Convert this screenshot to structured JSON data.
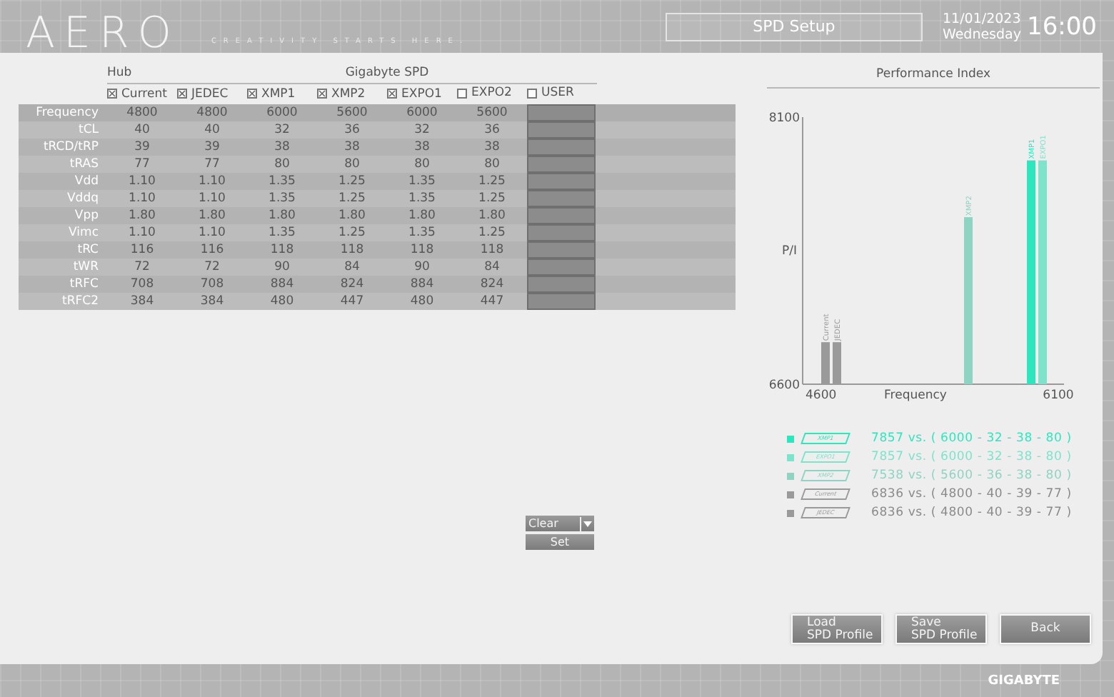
{
  "header": {
    "logo": "AERO",
    "tagline": "CREATIVITY STARTS HERE.",
    "title": "SPD Setup",
    "date": "11/01/2023",
    "day": "Wednesday",
    "time": "16:00"
  },
  "table": {
    "groups": [
      {
        "label": "Hub"
      },
      {
        "label": "Gigabyte SPD"
      }
    ],
    "columns": [
      {
        "label": "Current",
        "checked": true,
        "kind": "profile"
      },
      {
        "label": "JEDEC",
        "checked": true,
        "kind": "profile"
      },
      {
        "label": "XMP1",
        "checked": true,
        "kind": "profile"
      },
      {
        "label": "XMP2",
        "checked": true,
        "kind": "profile"
      },
      {
        "label": "EXPO1",
        "checked": true,
        "kind": "profile"
      },
      {
        "label": "EXPO2",
        "checked": false,
        "kind": "profile"
      },
      {
        "label": "USER",
        "checked": false,
        "kind": "user"
      }
    ],
    "rows": [
      {
        "label": "Frequency",
        "values": [
          "4800",
          "4800",
          "6000",
          "5600",
          "6000",
          "5600"
        ]
      },
      {
        "label": "tCL",
        "values": [
          "40",
          "40",
          "32",
          "36",
          "32",
          "36"
        ]
      },
      {
        "label": "tRCD/tRP",
        "values": [
          "39",
          "39",
          "38",
          "38",
          "38",
          "38"
        ]
      },
      {
        "label": "tRAS",
        "values": [
          "77",
          "77",
          "80",
          "80",
          "80",
          "80"
        ]
      },
      {
        "label": "Vdd",
        "values": [
          "1.10",
          "1.10",
          "1.35",
          "1.25",
          "1.35",
          "1.25"
        ]
      },
      {
        "label": "Vddq",
        "values": [
          "1.10",
          "1.10",
          "1.35",
          "1.25",
          "1.35",
          "1.25"
        ]
      },
      {
        "label": "Vpp",
        "values": [
          "1.80",
          "1.80",
          "1.80",
          "1.80",
          "1.80",
          "1.80"
        ]
      },
      {
        "label": "Vimc",
        "values": [
          "1.10",
          "1.10",
          "1.35",
          "1.25",
          "1.35",
          "1.25"
        ]
      },
      {
        "label": "tRC",
        "values": [
          "116",
          "116",
          "118",
          "118",
          "118",
          "118"
        ]
      },
      {
        "label": "tWR",
        "values": [
          "72",
          "72",
          "90",
          "84",
          "90",
          "84"
        ]
      },
      {
        "label": "tRFC",
        "values": [
          "708",
          "708",
          "884",
          "824",
          "884",
          "824"
        ]
      },
      {
        "label": "tRFC2",
        "values": [
          "384",
          "384",
          "480",
          "447",
          "480",
          "447"
        ]
      }
    ]
  },
  "user_controls": {
    "dropdown": "Clear",
    "button": "Set"
  },
  "performance": {
    "title": "Performance Index",
    "chart_data": {
      "type": "bar",
      "xlabel": "Frequency",
      "ylabel": "P/I",
      "x": [
        4800,
        5600,
        6000
      ],
      "xlim": [
        4600,
        6100
      ],
      "ylim": [
        6600,
        8100
      ],
      "xticks": [
        4600,
        6100
      ],
      "yticks": [
        6600,
        8100
      ],
      "series": [
        {
          "name": "Current",
          "color": "#9a9a9a",
          "values": [
            6836,
            null,
            null
          ]
        },
        {
          "name": "JEDEC",
          "color": "#9a9a9a",
          "values": [
            6836,
            null,
            null
          ]
        },
        {
          "name": "XMP2",
          "color": "#8fd3c3",
          "values": [
            null,
            7538,
            null
          ]
        },
        {
          "name": "XMP1",
          "color": "#2ee6be",
          "values": [
            null,
            null,
            7857
          ]
        },
        {
          "name": "EXPO1",
          "color": "#7fe2cb",
          "values": [
            null,
            null,
            7857
          ]
        }
      ]
    },
    "legend": [
      {
        "tag": "XMP1",
        "color": "#2ee6be",
        "text": "7857 vs. ( 6000 - 32 - 38 - 80 )"
      },
      {
        "tag": "EXPO1",
        "color": "#7fe2cb",
        "text": "7857 vs. ( 6000 - 32 - 38 - 80 )"
      },
      {
        "tag": "XMP2",
        "color": "#8fd3c3",
        "text": "7538 vs. ( 5600 - 36 - 38 - 80 )"
      },
      {
        "tag": "Current",
        "color": "#9a9a9a",
        "text": "6836 vs. ( 4800 - 40 - 39 - 77 )"
      },
      {
        "tag": "JEDEC",
        "color": "#9a9a9a",
        "text": "6836 vs. ( 4800 - 40 - 39 - 77 )"
      }
    ]
  },
  "buttons": [
    {
      "label": "Load\nSPD Profile"
    },
    {
      "label": "Save\nSPD Profile"
    },
    {
      "label": "Back"
    }
  ],
  "footer": {
    "brand": "GIGABYTE"
  }
}
